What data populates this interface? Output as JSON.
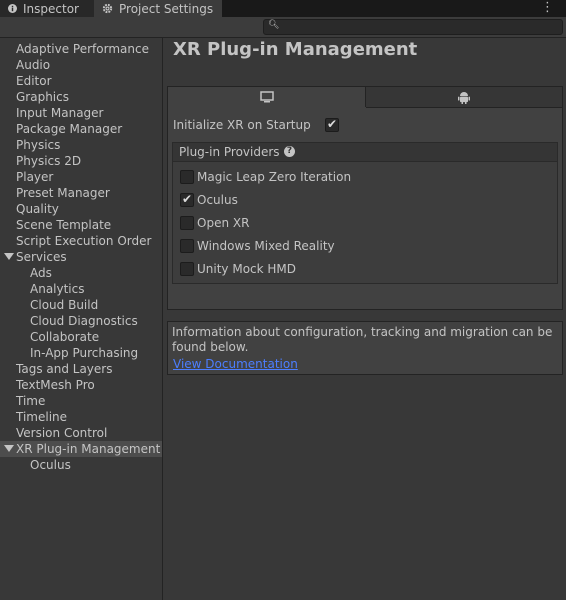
{
  "tabs": {
    "inspector": "Inspector",
    "project_settings": "Project Settings"
  },
  "search": {
    "placeholder": ""
  },
  "sidebar": {
    "items": [
      "Adaptive Performance",
      "Audio",
      "Editor",
      "Graphics",
      "Input Manager",
      "Package Manager",
      "Physics",
      "Physics 2D",
      "Player",
      "Preset Manager",
      "Quality",
      "Scene Template",
      "Script Execution Order",
      "Services",
      "Ads",
      "Analytics",
      "Cloud Build",
      "Cloud Diagnostics",
      "Collaborate",
      "In-App Purchasing",
      "Tags and Layers",
      "TextMesh Pro",
      "Time",
      "Timeline",
      "Version Control",
      "XR Plug-in Management",
      "Oculus"
    ]
  },
  "main": {
    "title": "XR Plug-in Management",
    "init_label": "Initialize XR on Startup",
    "init_checked": true,
    "providers_header": "Plug-in Providers",
    "providers": [
      {
        "label": "Magic Leap Zero Iteration",
        "checked": false
      },
      {
        "label": "Oculus",
        "checked": true
      },
      {
        "label": "Open XR",
        "checked": false
      },
      {
        "label": "Windows Mixed Reality",
        "checked": false
      },
      {
        "label": "Unity Mock HMD",
        "checked": false
      }
    ],
    "info_text": "Information about configuration, tracking and migration can be found below.",
    "doc_link": "View Documentation"
  },
  "colors": {
    "background": "#383838",
    "link": "#4c7eff",
    "selection": "#4d4d4d"
  }
}
